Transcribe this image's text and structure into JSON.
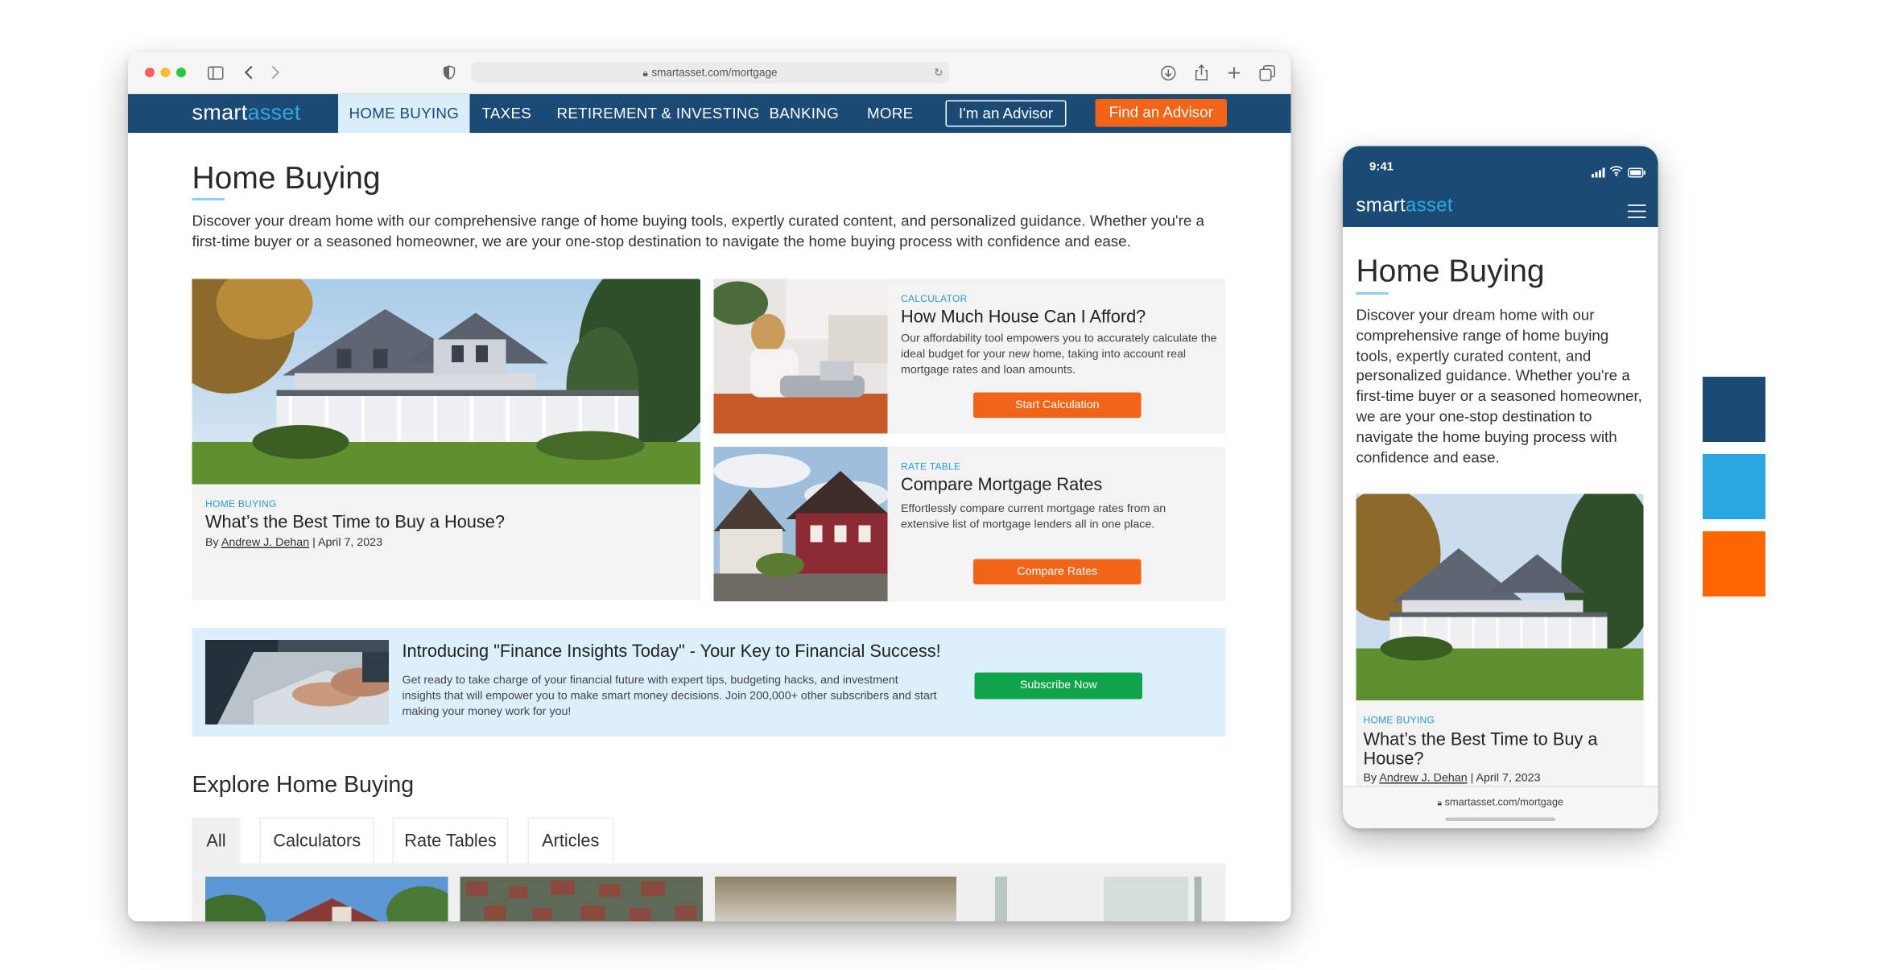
{
  "browser": {
    "url": "smartasset.com/mortgage"
  },
  "brand": {
    "logo_part1": "smart",
    "logo_part2": "asset",
    "colors": {
      "navy": "#1b4b75",
      "sky": "#2aa6e0",
      "orange": "#ff6600",
      "green": "#0fa34a"
    }
  },
  "nav": {
    "items": [
      "Home Buying",
      "Taxes",
      "Retirement & Investing",
      "Banking",
      "More"
    ],
    "active": "Home Buying",
    "advisor_button": "I'm an Advisor",
    "find_button": "Find an Advisor"
  },
  "page": {
    "title": "Home Buying",
    "intro": "Discover your dream home with our comprehensive range of home buying tools, expertly curated content, and personalized guidance. Whether you're a first-time buyer or a seasoned homeowner, we are your one-stop destination to navigate the home buying process with confidence and ease."
  },
  "featured": {
    "kicker": "Home Buying",
    "title": "What’s the Best Time to Buy a House?",
    "by_prefix": "By",
    "author": "Andrew J. Dehan",
    "date_sep": "|",
    "date": "April 7, 2023"
  },
  "calculator_card": {
    "kicker": "Calculator",
    "title": "How Much House Can I Afford?",
    "desc": "Our affordability tool empowers you to accurately calculate the ideal budget for your new home, taking into account real mortgage rates and loan amounts.",
    "button": "Start Calculation"
  },
  "rates_card": {
    "kicker": "Rate Table",
    "title": "Compare Mortgage Rates",
    "desc": "Effortlessly compare current mortgage rates from an extensive list of mortgage lenders all in one place.",
    "button": "Compare Rates"
  },
  "promo": {
    "title": "Introducing \"Finance Insights Today\" - Your Key to Financial Success!",
    "desc": "Get ready to take charge of your financial future with expert tips, budgeting hacks, and investment insights that will empower you to make smart money decisions. Join 200,000+ other subscribers and start making your money work for you!",
    "button": "Subscribe Now"
  },
  "explore": {
    "title": "Explore Home Buying",
    "tabs": [
      "All",
      "Calculators",
      "Rate Tables",
      "Articles"
    ],
    "active_tab": "All"
  },
  "mobile": {
    "time": "9:41",
    "url": "smartasset.com/mortgage",
    "title": "Home Buying",
    "intro": "Discover your dream home with our comprehensive range of home buying tools, expertly curated content, and personalized guidance. Whether you're a first-time buyer or a seasoned homeowner, we are your one-stop destination to navigate the home buying process with confidence and ease.",
    "kicker": "Home Buying",
    "card_title": "What’s the Best Time to Buy a House?",
    "by_prefix": "By",
    "author": "Andrew J. Dehan",
    "date_sep": "|",
    "date": "April 7, 2023"
  },
  "palette": [
    "#1b4b75",
    "#2aa6e0",
    "#ff6600"
  ]
}
